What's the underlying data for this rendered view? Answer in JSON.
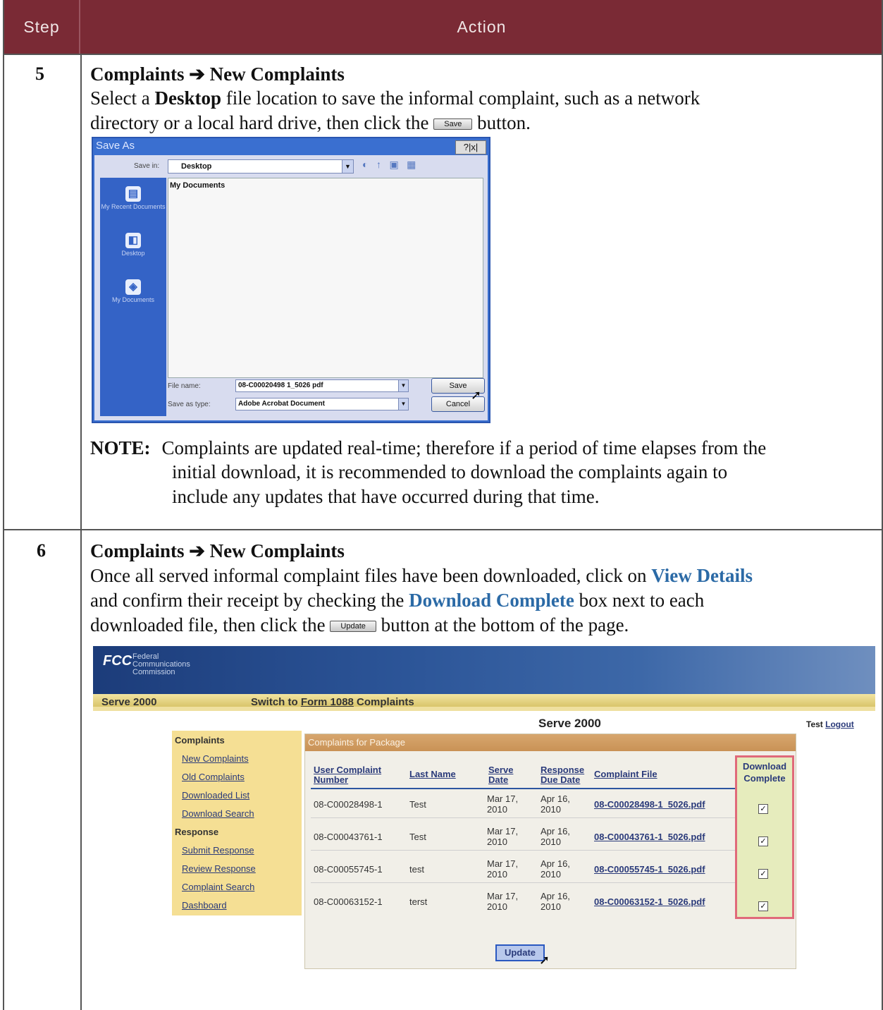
{
  "header": {
    "step": "Step",
    "action": "Action"
  },
  "step5": {
    "num": "5",
    "crumb_a": "Complaints",
    "arrow": "➔",
    "crumb_b": "New Complaints",
    "line1_a": "Select a ",
    "line1_b": "Desktop",
    "line1_c": " file location to save the informal complaint, such as a network",
    "line2_a": "directory or a local hard drive, then click the",
    "btn": "Save",
    "line2_b": "button.",
    "note_label": "NOTE:",
    "note_1": "Complaints are updated real-time; therefore if a period of time elapses from the",
    "note_2": "initial download, it is recommended to download the complaints again to",
    "note_3": "include any updates that have occurred during that time."
  },
  "dialog": {
    "title": "Save As",
    "help_close": "?|x|",
    "save_in_label": "Save in:",
    "save_in_value": "Desktop",
    "places": [
      "My Recent Documents",
      "Desktop",
      "My Documents"
    ],
    "file_item": "My Documents",
    "file_name_label": "File name:",
    "file_name_value": "08-C00020498 1_5026 pdf",
    "save_as_label": "Save as type:",
    "save_as_value": "Adobe Acrobat Document",
    "save_btn": "Save",
    "cancel_btn": "Cancel"
  },
  "step6": {
    "num": "6",
    "crumb_a": "Complaints",
    "arrow": "➔",
    "crumb_b": "New Complaints",
    "line1_a": "Once all served informal complaint files have been downloaded, click on ",
    "line1_b": "View Details",
    "line2_a": "and confirm their receipt by checking the ",
    "line2_b": "Download Complete",
    "line2_c": " box next to each",
    "line3_a": "downloaded file, then click the",
    "btn": "Update",
    "line3_b": "button at the bottom of the page."
  },
  "web": {
    "logo": "FCC",
    "logo_text": [
      "Federal",
      "Communications",
      "Commission"
    ],
    "nav_left": "Serve 2000",
    "nav_switch_a": "Switch to ",
    "nav_switch_link": "Form 1088",
    "nav_switch_b": " Complaints",
    "page_title": "Serve 2000",
    "user": "Test",
    "logout": "Logout",
    "side_h1": "Complaints",
    "side_links1": [
      "New Complaints",
      "Old Complaints",
      "Downloaded List",
      "Download Search"
    ],
    "side_h2": "Response",
    "side_links2": [
      "Submit Response",
      "Review Response",
      "Complaint Search",
      "Dashboard"
    ],
    "panel_title": "Complaints for Package",
    "columns": [
      "User Complaint Number",
      "Last Name",
      "Serve Date",
      "Response Due Date",
      "Complaint File",
      "Download Complete"
    ],
    "rows": [
      {
        "num": "08-C00028498-1",
        "last": "Test",
        "serve": "Mar 17, 2010",
        "due": "Apr 16, 2010",
        "file": "08-C00028498-1_5026.pdf",
        "check": "✓"
      },
      {
        "num": "08-C00043761-1",
        "last": "Test",
        "serve": "Mar 17, 2010",
        "due": "Apr 16, 2010",
        "file": "08-C00043761-1_5026.pdf",
        "check": "✓"
      },
      {
        "num": "08-C00055745-1",
        "last": "test",
        "serve": "Mar 17, 2010",
        "due": "Apr 16, 2010",
        "file": "08-C00055745-1_5026.pdf",
        "check": "✓"
      },
      {
        "num": "08-C00063152-1",
        "last": "terst",
        "serve": "Mar 17, 2010",
        "due": "Apr 16, 2010",
        "file": "08-C00063152-1_5026.pdf",
        "check": "✓"
      }
    ],
    "update_btn": "Update"
  }
}
